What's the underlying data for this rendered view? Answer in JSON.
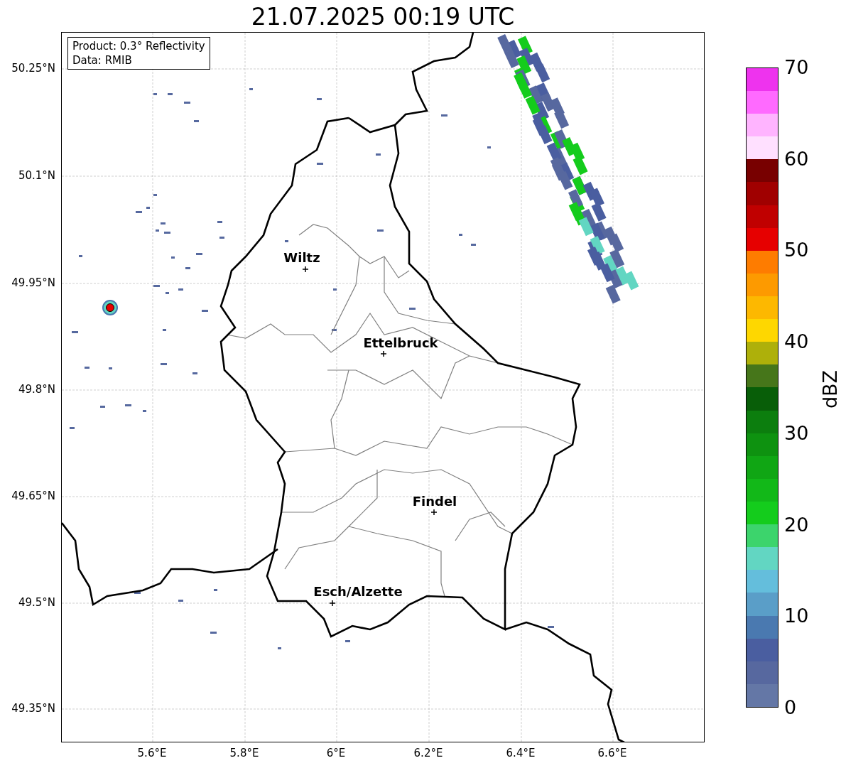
{
  "title": "21.07.2025 00:19 UTC",
  "legend": [
    "Product: 0.3° Reflectivity",
    "Data: RMIB"
  ],
  "y_ticks": [
    "50.25°N",
    "50.1°N",
    "49.95°N",
    "49.8°N",
    "49.65°N",
    "49.5°N",
    "49.35°N"
  ],
  "x_ticks": [
    "5.6°E",
    "5.8°E",
    "6°E",
    "6.2°E",
    "6.4°E",
    "6.6°E"
  ],
  "cities": [
    {
      "name": "Wiltz"
    },
    {
      "name": "Ettelbruck"
    },
    {
      "name": "Findel"
    },
    {
      "name": "Esch/Alzette"
    }
  ],
  "colorbar": {
    "label": "dBZ",
    "ticks": [
      "70",
      "60",
      "50",
      "40",
      "30",
      "20",
      "10",
      "0"
    ]
  }
}
